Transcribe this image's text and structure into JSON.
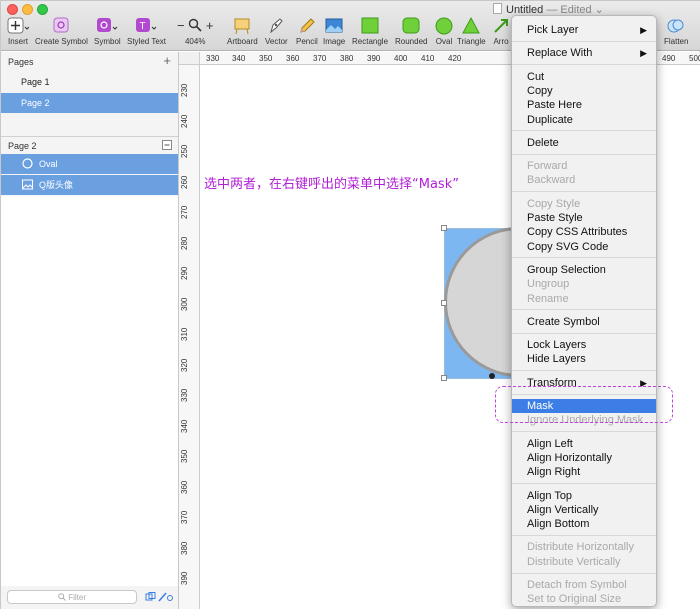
{
  "window": {
    "doc_title": "Untitled",
    "doc_status": "— Edited ⌄"
  },
  "toolbar": {
    "items": [
      {
        "label": "Insert"
      },
      {
        "label": "Create Symbol"
      },
      {
        "label": "Symbol"
      },
      {
        "label": "Styled Text"
      },
      {
        "label": "404%"
      },
      {
        "label": "Artboard"
      },
      {
        "label": "Vector"
      },
      {
        "label": "Pencil"
      },
      {
        "label": "Image"
      },
      {
        "label": "Rectangle"
      },
      {
        "label": "Rounded"
      },
      {
        "label": "Oval"
      },
      {
        "label": "Triangle"
      },
      {
        "label": "Arro"
      },
      {
        "label": "Flatten"
      }
    ],
    "zoom_minus": "−",
    "zoom_plus": "+"
  },
  "sidebar": {
    "pages_header": "Pages",
    "add_label": "+",
    "pages": [
      "Page 1",
      "Page 2"
    ],
    "layers_header": "Page 2",
    "layers": [
      {
        "name": "Oval",
        "icon": "oval-icon"
      },
      {
        "name": "Q版头像",
        "icon": "image-icon"
      }
    ],
    "filter_placeholder": "Filter"
  },
  "ruler_top": [
    "330",
    "340",
    "350",
    "360",
    "370",
    "380",
    "390",
    "400",
    "410",
    "420",
    "490",
    "500"
  ],
  "ruler_left": [
    "230",
    "240",
    "250",
    "260",
    "270",
    "280",
    "290",
    "300",
    "310",
    "320",
    "330",
    "340",
    "350",
    "360",
    "370",
    "380",
    "390"
  ],
  "annotation": "选中两者，在右键呼出的菜单中选择“Mask”",
  "context_menu": {
    "groups": [
      [
        {
          "label": "Pick Layer",
          "submenu": true,
          "enabled": true
        }
      ],
      [
        {
          "label": "Replace With",
          "submenu": true,
          "enabled": true
        }
      ],
      [
        {
          "label": "Cut",
          "enabled": true
        },
        {
          "label": "Copy",
          "enabled": true
        },
        {
          "label": "Paste Here",
          "enabled": true
        },
        {
          "label": "Duplicate",
          "enabled": true
        }
      ],
      [
        {
          "label": "Delete",
          "enabled": true
        }
      ],
      [
        {
          "label": "Forward",
          "enabled": false
        },
        {
          "label": "Backward",
          "enabled": false
        }
      ],
      [
        {
          "label": "Copy Style",
          "enabled": false
        },
        {
          "label": "Paste Style",
          "enabled": true
        },
        {
          "label": "Copy CSS Attributes",
          "enabled": true
        },
        {
          "label": "Copy SVG Code",
          "enabled": true
        }
      ],
      [
        {
          "label": "Group Selection",
          "enabled": true
        },
        {
          "label": "Ungroup",
          "enabled": false
        },
        {
          "label": "Rename",
          "enabled": false
        }
      ],
      [
        {
          "label": "Create Symbol",
          "enabled": true
        }
      ],
      [
        {
          "label": "Lock Layers",
          "enabled": true
        },
        {
          "label": "Hide Layers",
          "enabled": true
        }
      ],
      [
        {
          "label": "Transform",
          "submenu": true,
          "enabled": true
        }
      ],
      [
        {
          "label": "Mask",
          "enabled": true,
          "highlighted": true
        },
        {
          "label": "Ignore Underlying Mask",
          "enabled": false
        }
      ],
      [
        {
          "label": "Align Left",
          "enabled": true
        },
        {
          "label": "Align Horizontally",
          "enabled": true
        },
        {
          "label": "Align Right",
          "enabled": true
        }
      ],
      [
        {
          "label": "Align Top",
          "enabled": true
        },
        {
          "label": "Align Vertically",
          "enabled": true
        },
        {
          "label": "Align Bottom",
          "enabled": true
        }
      ],
      [
        {
          "label": "Distribute Horizontally",
          "enabled": false
        },
        {
          "label": "Distribute Vertically",
          "enabled": false
        }
      ],
      [
        {
          "label": "Detach from Symbol",
          "enabled": false
        },
        {
          "label": "Set to Original Size",
          "enabled": false
        }
      ]
    ]
  },
  "colors": {
    "selection_blue": "#6a9fe0",
    "menu_highlight": "#3c7ee6",
    "annotation_purple": "#b01fd6",
    "image_fill": "#7db7f2",
    "oval_fill": "#d6d6d6"
  }
}
